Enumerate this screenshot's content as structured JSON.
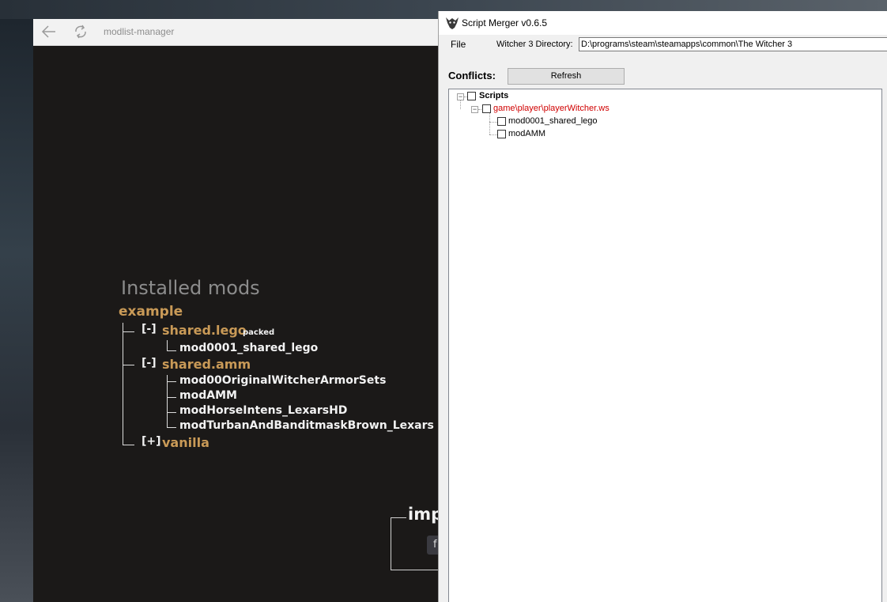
{
  "modlist_manager": {
    "window_title": "modlist-manager",
    "heading": "Installed mods",
    "root_label": "example",
    "groups": [
      {
        "toggle": "[-]",
        "name": "shared.lego",
        "tag": "packed",
        "items": [
          "mod0001_shared_lego"
        ]
      },
      {
        "toggle": "[-]",
        "name": "shared.amm",
        "items": [
          "mod00OriginalWitcherArmorSets",
          "modAMM",
          "modHorseIntens_LexarsHD",
          "modTurbanAndBanditmaskBrown_Lexars"
        ]
      },
      {
        "toggle": "[+]",
        "name": "vanilla"
      }
    ],
    "import_label": "imp",
    "import_button_label": "f"
  },
  "script_merger": {
    "window_title": "Script Merger v0.6.5",
    "file_menu": "File",
    "directory_label": "Witcher 3 Directory:",
    "directory_value": "D:\\programs\\steam\\steamapps\\common\\The Witcher 3",
    "conflicts_label": "Conflicts:",
    "refresh_label": "Refresh",
    "tree": {
      "root": "Scripts",
      "file": "game\\player\\playerWitcher.ws",
      "mods": [
        "mod0001_shared_lego",
        "modAMM"
      ]
    },
    "colors": {
      "conflict_file": "#d00000"
    }
  },
  "colors": {
    "group_accent": "#c99a57",
    "app_background": "#1b1918"
  },
  "icons": {
    "back": "arrow-left-icon",
    "refresh": "refresh-icon",
    "merger_app": "wolf-medallion-icon",
    "collapse": "minus-box-icon"
  }
}
